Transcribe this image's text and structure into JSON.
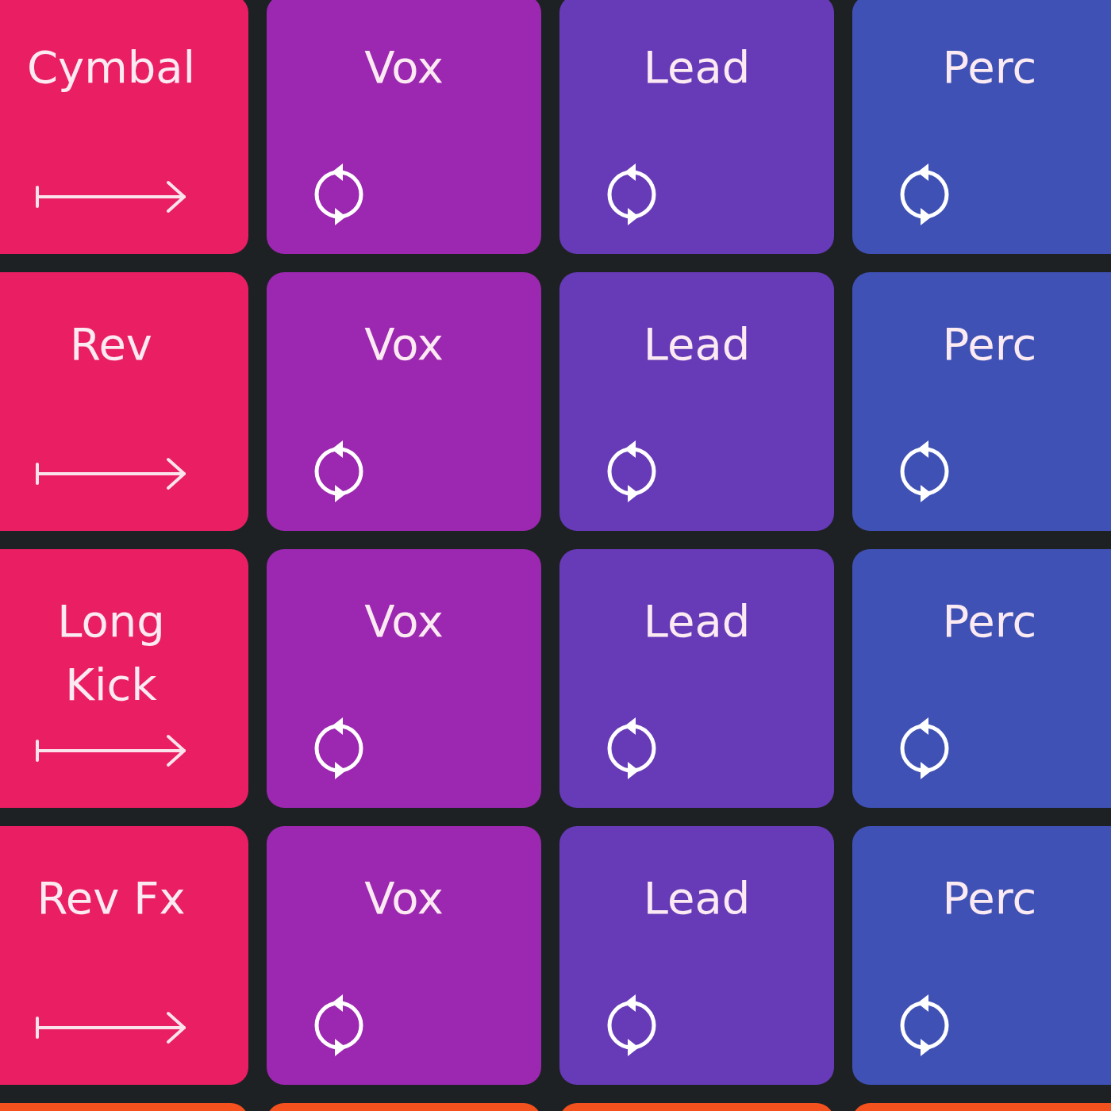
{
  "pads": [
    {
      "label": "Cymbal",
      "kind": "oneshot",
      "color": "#e91e63"
    },
    {
      "label": "Vox",
      "kind": "loop",
      "color": "#9c27b0"
    },
    {
      "label": "Lead",
      "kind": "loop",
      "color": "#673ab7"
    },
    {
      "label": "Perc",
      "kind": "loop",
      "color": "#3f51b5"
    },
    {
      "label": "Rev",
      "kind": "oneshot",
      "color": "#e91e63"
    },
    {
      "label": "Vox",
      "kind": "loop",
      "color": "#9c27b0"
    },
    {
      "label": "Lead",
      "kind": "loop",
      "color": "#673ab7"
    },
    {
      "label": "Perc",
      "kind": "loop",
      "color": "#3f51b5"
    },
    {
      "label": "Long\nKick",
      "kind": "oneshot",
      "color": "#e91e63"
    },
    {
      "label": "Vox",
      "kind": "loop",
      "color": "#9c27b0"
    },
    {
      "label": "Lead",
      "kind": "loop",
      "color": "#673ab7"
    },
    {
      "label": "Perc",
      "kind": "loop",
      "color": "#3f51b5"
    },
    {
      "label": "Rev Fx",
      "kind": "oneshot",
      "color": "#e91e63"
    },
    {
      "label": "Vox",
      "kind": "loop",
      "color": "#9c27b0"
    },
    {
      "label": "Lead",
      "kind": "loop",
      "color": "#673ab7"
    },
    {
      "label": "Perc",
      "kind": "loop",
      "color": "#3f51b5"
    },
    {
      "color": "#f4511e"
    },
    {
      "color": "#f4511e"
    },
    {
      "color": "#f4511e"
    },
    {
      "color": "#f4511e"
    }
  ]
}
